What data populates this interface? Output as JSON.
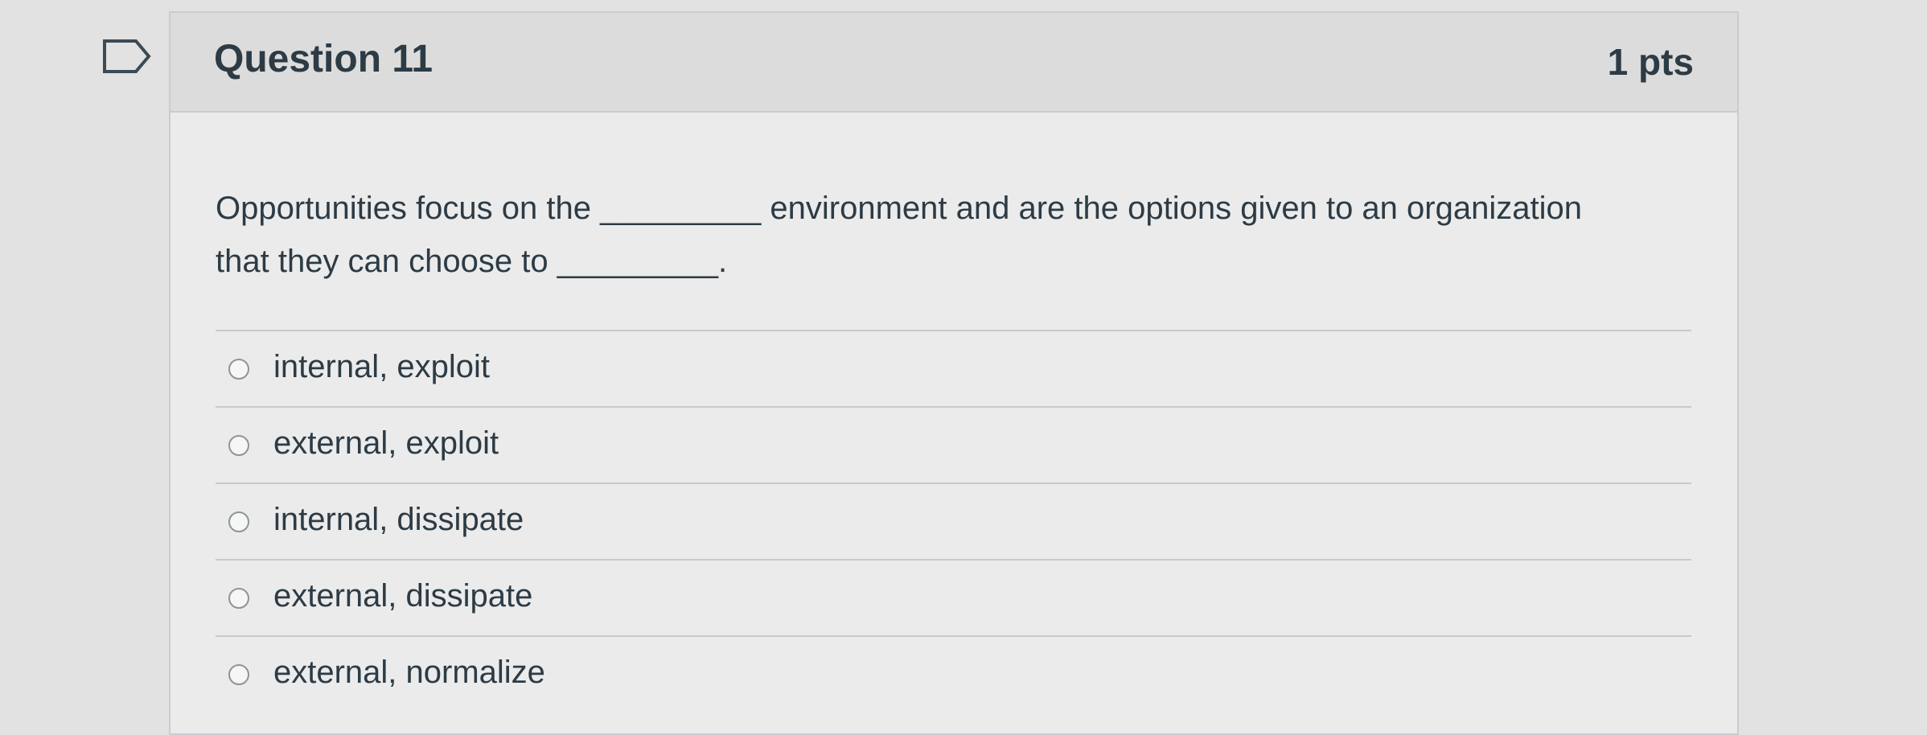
{
  "question": {
    "title": "Question 11",
    "points": "1 pts",
    "text_line_1": "Opportunities focus on the _________ environment and are the options given to an organization",
    "text_line_2": "that they can choose to _________."
  },
  "answers": [
    {
      "label": "internal, exploit",
      "selected": false
    },
    {
      "label": "external, exploit",
      "selected": false
    },
    {
      "label": "internal, dissipate",
      "selected": false
    },
    {
      "label": "external, dissipate",
      "selected": false
    },
    {
      "label": "external, normalize",
      "selected": false
    }
  ],
  "icons": {
    "flag": "flag-icon"
  }
}
